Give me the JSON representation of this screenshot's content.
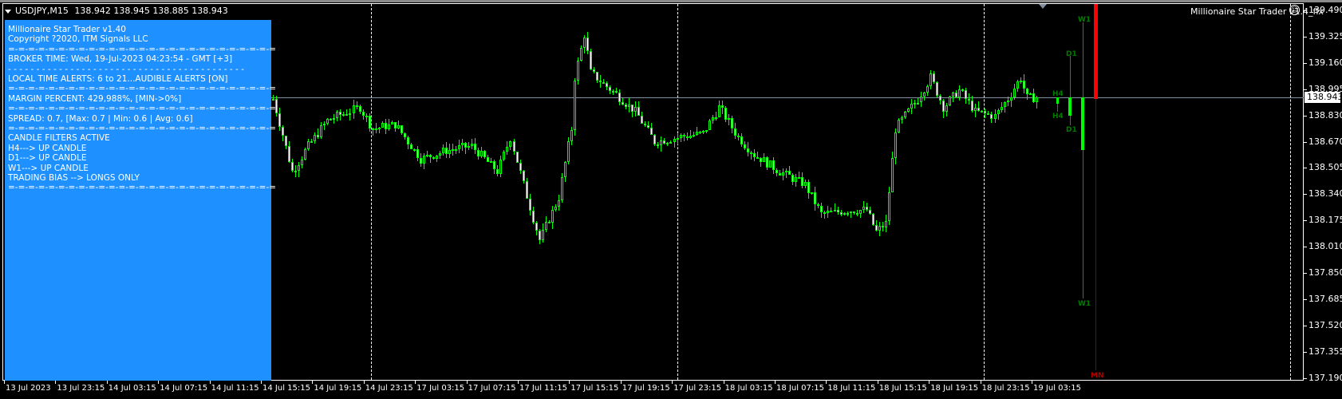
{
  "header": {
    "symbol": "USDJPY,M15",
    "ohlc": "138.942 138.945 138.885 138.943"
  },
  "panel": {
    "lines": [
      "Millionaire Star Trader v1.40",
      "Copyright ?2020, ITM Signals LLC",
      "=-=-=-=-=-=-=-=-=-=-=-=-=-=-=-=-=-=-=-=-=-=-=-=-=-=-=",
      "BROKER TIME: Wed, 19-Jul-2023 04:23:54 - GMT [+3]",
      "- - - - - - - - - - - - - - - - - - - - - - - - - - - - - - - - - - - - - - - - - -",
      "LOCAL TIME ALERTS: 6 to 21...AUDIBLE ALERTS [ON]",
      "=-=-=-=-=-=-=-=-=-=-=-=-=-=-=-=-=-=-=-=-=-=-=-=-=-=-=",
      "MARGIN PERCENT: 429,988%, [MIN->0%]",
      "=-=-=-=-=-=-=-=-=-=-=-=-=-=-=-=-=-=-=-=-=-=-=-=-=-=-=",
      "SPREAD: 0.7, [Max: 0.7 | Min: 0.6 | Avg: 0.6]",
      "=-=-=-=-=-=-=-=-=-=-=-=-=-=-=-=-=-=-=-=-=-=-=-=-=-=-=",
      "CANDLE FILTERS ACTIVE",
      "H4---> UP CANDLE",
      "D1---> UP CANDLE",
      "W1---> UP CANDLE",
      "TRADING BIAS --> LONGS ONLY",
      "=-=-=-=-=-=-=-=-=-=-=-=-=-=-=-=-=-=-=-=-=-=-=-=-=-=-="
    ]
  },
  "ea_name": "Millionaire Star Trader v1.4_fix",
  "ea_icon": "smiley-icon",
  "price_axis": {
    "labels": [
      "139.490",
      "139.325",
      "139.160",
      "138.995",
      "138.830",
      "138.670",
      "138.505",
      "138.340",
      "138.175",
      "138.010",
      "137.850",
      "137.685",
      "137.520",
      "137.355",
      "137.190"
    ],
    "current_price": "138.943"
  },
  "time_axis": {
    "labels": [
      "13 Jul 2023",
      "13 Jul 23:15",
      "14 Jul 03:15",
      "14 Jul 07:15",
      "14 Jul 11:15",
      "14 Jul 15:15",
      "14 Jul 19:15",
      "14 Jul 23:15",
      "17 Jul 03:15",
      "17 Jul 07:15",
      "17 Jul 11:15",
      "17 Jul 15:15",
      "17 Jul 19:15",
      "17 Jul 23:15",
      "18 Jul 03:15",
      "18 Jul 07:15",
      "18 Jul 11:15",
      "18 Jul 15:15",
      "18 Jul 19:15",
      "18 Jul 23:15",
      "19 Jul 03:15"
    ]
  },
  "mtf": {
    "h4_label": "H4",
    "d1_label": "D1",
    "w1_label": "W1",
    "mn_label": "MN"
  },
  "colors": {
    "panel": "#1e90ff",
    "bull": "#00ff00",
    "mtf_label": "#007a00",
    "mn": "#ff0000"
  },
  "chart_data": {
    "type": "candlestick",
    "ylim": [
      137.19,
      139.49
    ],
    "price_path": [
      [
        0,
        138.935
      ],
      [
        6,
        138.476
      ],
      [
        11,
        138.638
      ],
      [
        17,
        138.8
      ],
      [
        27,
        138.881
      ],
      [
        31,
        138.746
      ],
      [
        38,
        138.773
      ],
      [
        46,
        138.557
      ],
      [
        54,
        138.611
      ],
      [
        62,
        138.638
      ],
      [
        70,
        138.476
      ],
      [
        74,
        138.692
      ],
      [
        78,
        138.395
      ],
      [
        83,
        138.045
      ],
      [
        89,
        138.315
      ],
      [
        93,
        138.746
      ],
      [
        94,
        139.069
      ],
      [
        97,
        139.339
      ],
      [
        99,
        139.096
      ],
      [
        107,
        138.962
      ],
      [
        113,
        138.854
      ],
      [
        119,
        138.665
      ],
      [
        126,
        138.692
      ],
      [
        134,
        138.719
      ],
      [
        139,
        138.881
      ],
      [
        145,
        138.692
      ],
      [
        150,
        138.584
      ],
      [
        158,
        138.476
      ],
      [
        166,
        138.395
      ],
      [
        171,
        138.207
      ],
      [
        179,
        138.234
      ],
      [
        185,
        138.234
      ],
      [
        188,
        138.099
      ],
      [
        191,
        138.153
      ],
      [
        194,
        138.746
      ],
      [
        201,
        138.935
      ],
      [
        205,
        139.069
      ],
      [
        209,
        138.881
      ],
      [
        214,
        138.989
      ],
      [
        219,
        138.854
      ],
      [
        225,
        138.827
      ],
      [
        229,
        138.935
      ],
      [
        233,
        139.069
      ],
      [
        235,
        138.935
      ],
      [
        238,
        138.943
      ]
    ]
  }
}
